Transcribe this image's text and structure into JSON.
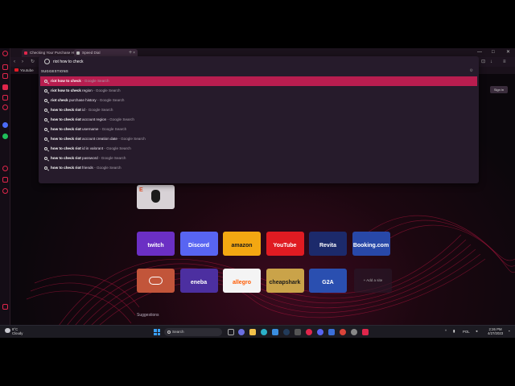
{
  "tabs": [
    {
      "label": "Checking Your Purchase H...",
      "active": false
    },
    {
      "label": "Speed Dial",
      "active": true
    }
  ],
  "new_tab_label": "+",
  "bookmarks": [
    {
      "label": "Youtube"
    }
  ],
  "omnibox": {
    "value": "riot how to check",
    "suggestions_header": "SUGGESTIONS",
    "suggestions": [
      {
        "bold": "riot how to check",
        "rest": "",
        "source": "- Google Search"
      },
      {
        "bold": "riot how to check",
        "rest": " region",
        "source": "- Google Search"
      },
      {
        "bold": "riot check",
        "rest": " purchase history",
        "source": "- Google Search"
      },
      {
        "bold": "how to check riot",
        "rest": " id",
        "source": "- Google Search"
      },
      {
        "bold": "how to check riot",
        "rest": " account region",
        "source": "- Google Search"
      },
      {
        "bold": "how to check riot",
        "rest": " username",
        "source": "- Google Search"
      },
      {
        "bold": "how to check riot",
        "rest": " account creation date",
        "source": "- Google Search"
      },
      {
        "bold": "how to check riot",
        "rest": " id in valorant",
        "source": "- Google Search"
      },
      {
        "bold": "how to check riot",
        "rest": " password",
        "source": "- Google Search"
      },
      {
        "bold": "how to check riot",
        "rest": " friends",
        "source": "- Google Search"
      }
    ]
  },
  "signin_label": "Sign in",
  "speed_dial": {
    "row1": [
      {
        "label": "twitch",
        "bg": "#6b2fc4",
        "fg": "#ffffff"
      },
      {
        "label": "Discord",
        "bg": "#5865f2",
        "fg": "#ffffff"
      },
      {
        "label": "amazon",
        "bg": "#f3a712",
        "fg": "#1a1a1a"
      },
      {
        "label": "YouTube",
        "bg": "#e01b22",
        "fg": "#ffffff"
      },
      {
        "label": "Revita",
        "bg": "#1c2a6b",
        "fg": "#ffffff"
      },
      {
        "label": "Booking.com",
        "bg": "#2848a8",
        "fg": "#ffffff"
      }
    ],
    "row2": [
      {
        "label": "",
        "bg": "#c2553a",
        "fg": "#ffffff"
      },
      {
        "label": "eneba",
        "bg": "#4c2fa0",
        "fg": "#ffffff"
      },
      {
        "label": "allegro",
        "bg": "#f4f4f4",
        "fg": "#ff5a00"
      },
      {
        "label": "cheapshark",
        "bg": "#caa349",
        "fg": "#1a1a1a"
      },
      {
        "label": "G2A",
        "bg": "#2a4fb0",
        "fg": "#ffffff"
      }
    ],
    "add_site_label": "+ Add a site",
    "suggestions_label": "Suggestions"
  },
  "taskbar": {
    "weather_temp": "8°C",
    "weather_desc": "Cloudy",
    "search_label": "Search",
    "lang": "POL",
    "time": "2:26 PM",
    "date": "4/27/2023"
  }
}
